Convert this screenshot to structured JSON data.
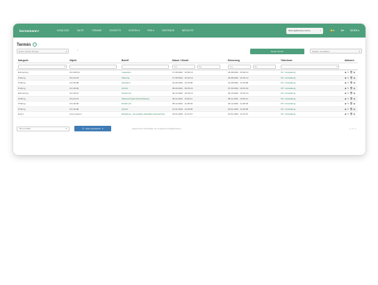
{
  "app": {
    "logo": "bornemann+"
  },
  "nav": [
    "KATALOGE",
    "TAKTE",
    "TERMINE",
    "SCHRITTE",
    "KOSTEN ▾",
    "PMS ▾",
    "VERTRÄGE",
    "BERICHTE"
  ],
  "search": {
    "label": "Bitzung/Betriebs Suche",
    "icon": "search-icon"
  },
  "top_icons": {
    "bell": "🔔▾",
    "gear": "⚙▾",
    "lang": "DE/EN ▾"
  },
  "page": {
    "title": "Termin",
    "info": "?"
  },
  "controls": {
    "filter_select": "Ersten Schritt fertigen",
    "trash_badge": "i",
    "new_button": "Neuer Termin",
    "view_select": "Spalten auswählen"
  },
  "table": {
    "headers": [
      "Kategorie",
      "Objekt",
      "Betreff",
      "Datum / Uhrzeit",
      "Erinnerung",
      "Teilnehmer",
      "Aktionen"
    ],
    "filters": {
      "from": "Von",
      "to": "Bis"
    },
    "rows": [
      {
        "kategorie": "Erinnerung",
        "objekt": "CO-118-04",
        "betreff": "Inspektion",
        "datum": "17.08.2022 · 10:00:13",
        "erinnerung": "18.08.2022 · 09:00:13",
        "teilnehmer": "FP • Verwaltung"
      },
      {
        "kategorie": "Prüfung",
        "objekt": "OG-42-18",
        "betreff": "Wartung",
        "datum": "27.08.2022 · 10:16:13",
        "erinnerung": "26.08.2022 · 22:16:13",
        "teilnehmer": "FP • Verwaltung"
      },
      {
        "kategorie": "Prüfung",
        "objekt": "CO-18-08",
        "betreff": "Abnahme",
        "datum": "01.09.2022 · 11:15:08",
        "erinnerung": "31.08.2022 · 11:15:08",
        "teilnehmer": "FP • Verwaltung"
      },
      {
        "kategorie": "Prüfung",
        "objekt": "CO-18-09",
        "betreff": "HU/AU",
        "datum": "08.09.2022 · 09:15:22",
        "erinnerung": "07.09.2022 · 09:15:22",
        "teilnehmer": "FP • Verwaltung"
      },
      {
        "kategorie": "Erinnerung",
        "objekt": "CO-18-14",
        "betreff": "Ortstermin",
        "datum": "04.10.2022 · 15:31:13",
        "erinnerung": "03.10.2022 · 15:31:13",
        "teilnehmer": "FP • Verwaltung"
      },
      {
        "kategorie": "Prüfung",
        "objekt": "OG-42-16",
        "betreff": "Wasserschadensbesichtigung",
        "datum": "09.11.2022 · 14:00:11",
        "erinnerung": "08.11.2022 · 14:00:11",
        "teilnehmer": "FP • Verwaltung"
      },
      {
        "kategorie": "Prüfung",
        "objekt": "CO-18-06",
        "betreff": "Rohrbruch",
        "datum": "05.12.2022 · 11:28:18",
        "erinnerung": "04.12.2022 · 11:28:18",
        "teilnehmer": "FP • Verwaltung"
      },
      {
        "kategorie": "Prüfung",
        "objekt": "CO-18-08",
        "betreff": "HU/AU",
        "datum": "21.01.2023 · 11:09:08",
        "erinnerung": "20.01.2023 · 11:09:08",
        "teilnehmer": "FP • Verwaltung"
      },
      {
        "kategorie": "Event",
        "objekt": "Lorem Ipsum",
        "betreff": "Einladung - Homeoffice Aktivitäten Einweihung",
        "datum": "23.01.2023 · 11:21:37",
        "erinnerung": "22.01.2023 · 11:21:37",
        "teilnehmer": "FP • Verwaltung"
      }
    ]
  },
  "footer": {
    "page_size": "20 pro Seite",
    "export": "Liste exportieren",
    "summary": "Zeige Ihnen 9 Einträge von insgesamt 9 Ergebnissen",
    "pager": "« ‹ 1 › »"
  }
}
